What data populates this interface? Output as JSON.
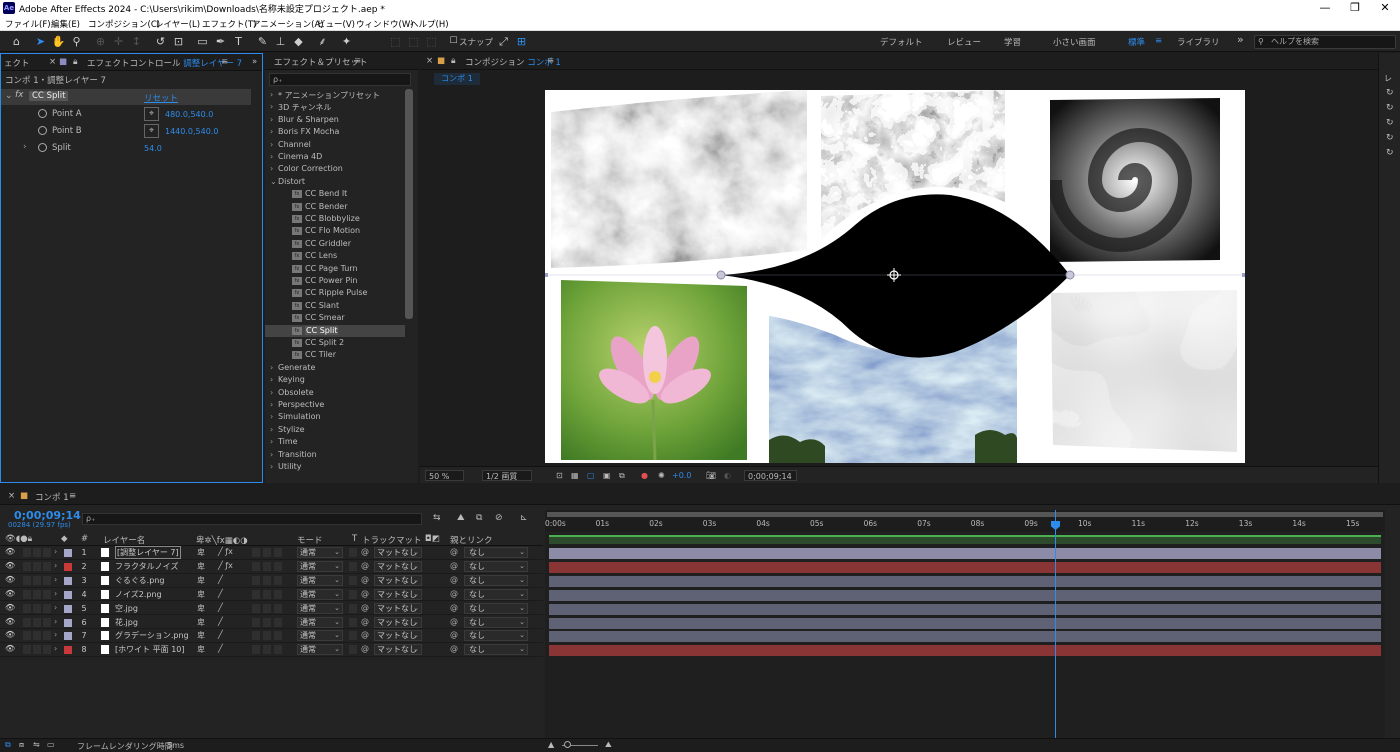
{
  "window": {
    "title": "Adobe After Effects 2024 - C:\\Users\\rikim\\Downloads\\名称未設定プロジェクト.aep *",
    "app_icon": "Ae",
    "minimize": "—",
    "maximize": "❐",
    "close": "✕"
  },
  "menu": [
    "ファイル(F)",
    "編集(E)",
    "コンポジション(C)",
    "レイヤー(L)",
    "エフェクト(T)",
    "アニメーション(A)",
    "ビュー(V)",
    "ウィンドウ(W)",
    "ヘルプ(H)"
  ],
  "toolbar": {
    "snap_label": "スナップ",
    "workspaces": [
      "デフォルト",
      "レビュー",
      "学習",
      "小さい画面",
      "標準",
      "ライブラリ"
    ],
    "active_workspace": "標準",
    "help_placeholder": "ヘルプを検索",
    "more": "»"
  },
  "effect_controls": {
    "tab_left": "ェクト",
    "tab_label": "エフェクトコントロール",
    "tab_layer": "調整レイヤー 7",
    "subtitle": "コンポ 1・調整レイヤー 7",
    "effect_name": "CC Split",
    "reset": "リセット",
    "fx": "fx",
    "properties": [
      {
        "name": "Point A",
        "value": "480.0,540.0"
      },
      {
        "name": "Point B",
        "value": "1440.0,540.0"
      },
      {
        "name": "Split",
        "value": "54.0"
      }
    ]
  },
  "effects_presets": {
    "tab_label": "エフェクト＆プリセット",
    "search_placeholder": "ρ₊",
    "items": [
      {
        "label": "* アニメーションプリセット",
        "child": false
      },
      {
        "label": "3D チャンネル",
        "child": false
      },
      {
        "label": "Blur & Sharpen",
        "child": false
      },
      {
        "label": "Boris FX Mocha",
        "child": false
      },
      {
        "label": "Channel",
        "child": false
      },
      {
        "label": "Cinema 4D",
        "child": false
      },
      {
        "label": "Color Correction",
        "child": false
      },
      {
        "label": "Distort",
        "child": false,
        "open": true
      },
      {
        "label": "CC Bend It",
        "child": true
      },
      {
        "label": "CC Bender",
        "child": true
      },
      {
        "label": "CC Blobbylize",
        "child": true
      },
      {
        "label": "CC Flo Motion",
        "child": true
      },
      {
        "label": "CC Griddler",
        "child": true
      },
      {
        "label": "CC Lens",
        "child": true
      },
      {
        "label": "CC Page Turn",
        "child": true
      },
      {
        "label": "CC Power Pin",
        "child": true
      },
      {
        "label": "CC Ripple Pulse",
        "child": true
      },
      {
        "label": "CC Slant",
        "child": true
      },
      {
        "label": "CC Smear",
        "child": true
      },
      {
        "label": "CC Split",
        "child": true,
        "selected": true
      },
      {
        "label": "CC Split 2",
        "child": true
      },
      {
        "label": "CC Tiler",
        "child": true
      },
      {
        "label": "Generate",
        "child": false
      },
      {
        "label": "Keying",
        "child": false
      },
      {
        "label": "Obsolete",
        "child": false
      },
      {
        "label": "Perspective",
        "child": false
      },
      {
        "label": "Simulation",
        "child": false
      },
      {
        "label": "Stylize",
        "child": false
      },
      {
        "label": "Time",
        "child": false
      },
      {
        "label": "Transition",
        "child": false
      },
      {
        "label": "Utility",
        "child": false
      }
    ]
  },
  "composition": {
    "tab_label": "コンポジション",
    "comp_name": "コンポ 1",
    "zoom": "50 %",
    "resolution": "1/2 画質",
    "exposure": "+0.0",
    "timecode": "0;00;09;14"
  },
  "timeline": {
    "tab_label": "コンポ 1",
    "timecode": "0;00;09;14",
    "fps": "00284 (29.97 fps)",
    "search_placeholder": "ρ₊",
    "headers": {
      "layer_name": "レイヤー名",
      "number": "#",
      "mode": "モード",
      "t": "T",
      "track_matte": "トラックマット",
      "parent": "親とリンク"
    },
    "ticks": [
      "0:00s",
      "01s",
      "02s",
      "03s",
      "04s",
      "05s",
      "06s",
      "07s",
      "08s",
      "09s",
      "10s",
      "11s",
      "12s",
      "13s",
      "14s",
      "15s"
    ],
    "layers": [
      {
        "num": "1",
        "name": "[調整レイヤー 7]",
        "color": "#a5a6c8",
        "mode": "通常",
        "matte": "マットなし",
        "parent": "なし",
        "bar": "#8c8ca8",
        "fx": true
      },
      {
        "num": "2",
        "name": "フラクタルノイズ",
        "color": "#c83a3a",
        "mode": "通常",
        "matte": "マットなし",
        "parent": "なし",
        "bar": "#8a3535",
        "fx": true
      },
      {
        "num": "3",
        "name": "ぐるぐる.png",
        "color": "#a5a6c8",
        "mode": "通常",
        "matte": "マットなし",
        "parent": "なし",
        "bar": "#5f6274",
        "fx": false
      },
      {
        "num": "4",
        "name": "ノイズ2.png",
        "color": "#a5a6c8",
        "mode": "通常",
        "matte": "マットなし",
        "parent": "なし",
        "bar": "#5f6274",
        "fx": false
      },
      {
        "num": "5",
        "name": "空.jpg",
        "color": "#a5a6c8",
        "mode": "通常",
        "matte": "マットなし",
        "parent": "なし",
        "bar": "#5f6274",
        "fx": false
      },
      {
        "num": "6",
        "name": "花.jpg",
        "color": "#a5a6c8",
        "mode": "通常",
        "matte": "マットなし",
        "parent": "なし",
        "bar": "#5f6274",
        "fx": false
      },
      {
        "num": "7",
        "name": "グラデーション.png",
        "color": "#a5a6c8",
        "mode": "通常",
        "matte": "マットなし",
        "parent": "なし",
        "bar": "#5f6274",
        "fx": false
      },
      {
        "num": "8",
        "name": "[ホワイト 平面 10]",
        "color": "#c83a3a",
        "mode": "通常",
        "matte": "マットなし",
        "parent": "なし",
        "bar": "#8a3535",
        "fx": false
      }
    ]
  },
  "status": {
    "render_label": "フレームレンダリング時間",
    "render_value": "5ms"
  },
  "colors": {
    "accent": "#2d8ceb",
    "panel": "#232323",
    "background": "#1d1d1d"
  }
}
